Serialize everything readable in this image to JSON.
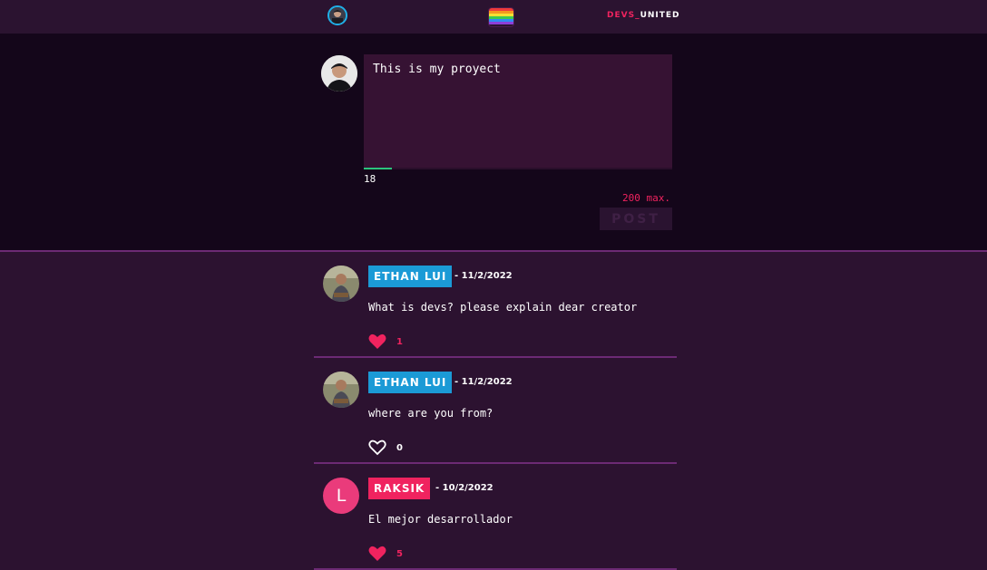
{
  "header": {
    "brand_part1": "DEVS_",
    "brand_part2": "UNITED",
    "avatar_icon": "user-avatar",
    "logo_icon": "rainbow-logo",
    "logo_colors": [
      "#f03b3b",
      "#f39a1e",
      "#f7e032",
      "#3cc94f",
      "#2f8cf1",
      "#8d3fd9"
    ]
  },
  "composer": {
    "text": "This is my proyect",
    "char_count": "18",
    "max_label": "200 max.",
    "post_label": "POST",
    "progress_fraction": 0.09,
    "progress_color": "#2bc37c"
  },
  "posts": [
    {
      "username": "ETHAN LUI",
      "date": "- 11/2/2022",
      "text": "What is devs? please explain dear creator",
      "likes": "1",
      "liked": true,
      "tag_color": "#1b9ad6"
    },
    {
      "username": "ETHAN LUI",
      "date": "- 11/2/2022",
      "text": "where are you from?",
      "likes": "0",
      "liked": false,
      "tag_color": "#1b9ad6"
    },
    {
      "username": "RAKSIK",
      "avatar_letter": "L",
      "date": "- 10/2/2022",
      "text": "El mejor desarrollador",
      "likes": "5",
      "liked": true,
      "tag_color": "#f0235f"
    }
  ],
  "colors": {
    "accent_pink": "#f0235f",
    "liked_heart": "#f0235f",
    "unliked_heart": "#ffffff"
  }
}
